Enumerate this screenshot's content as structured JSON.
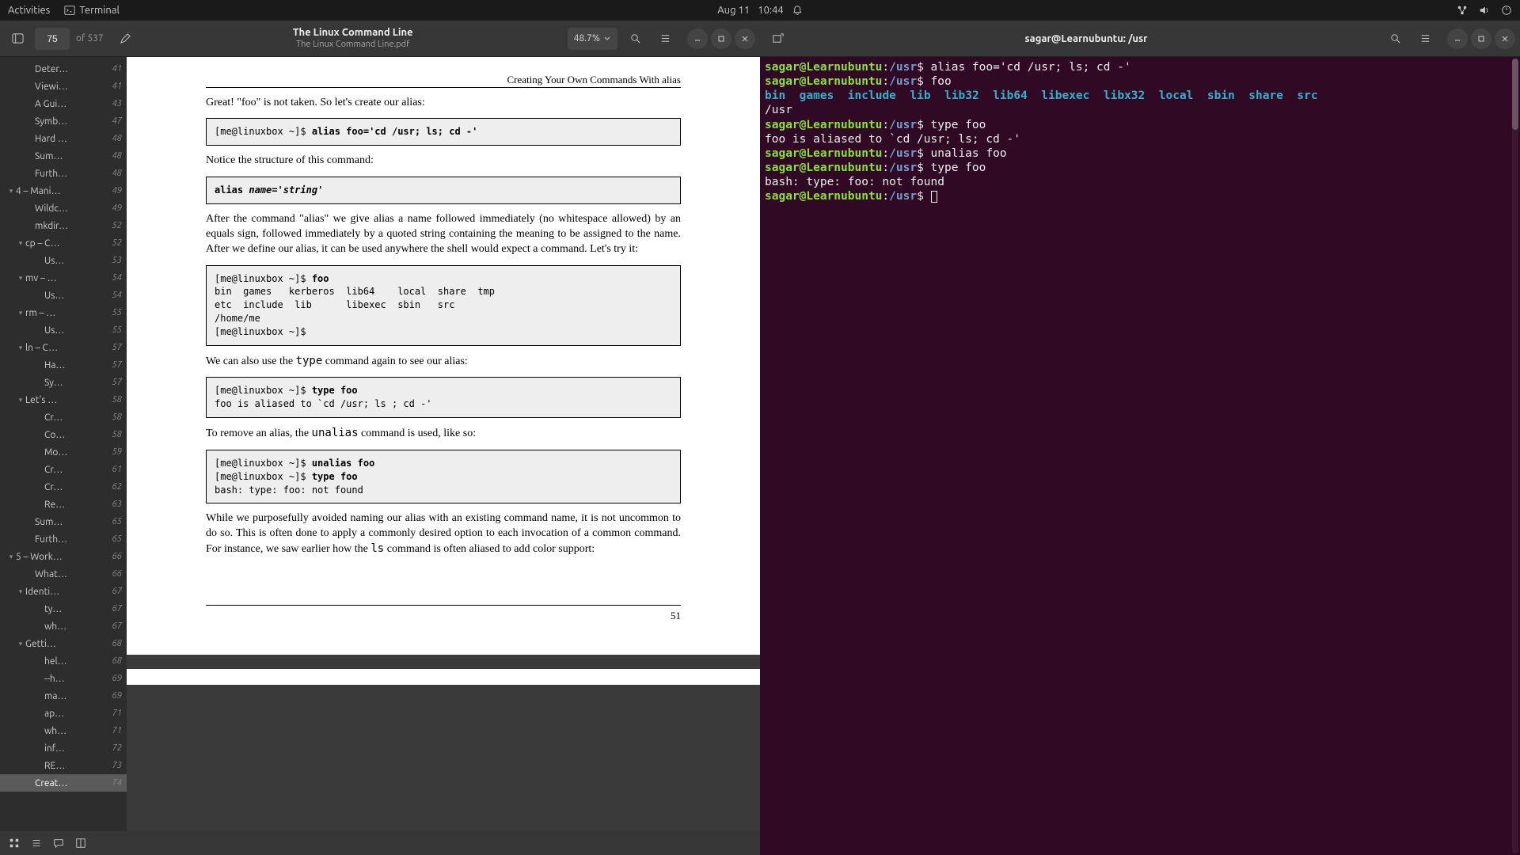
{
  "topbar": {
    "activities": "Activities",
    "app": "Terminal",
    "date": "Aug 11",
    "time": "10:44"
  },
  "pdf": {
    "title": "The Linux Command Line",
    "subtitle": "The Linux Command Line.pdf",
    "page_current": "75",
    "page_total": "of 537",
    "zoom": "48.7%",
    "outline": [
      {
        "indent": 2,
        "tri": "",
        "label": "Deter…",
        "pg": "41"
      },
      {
        "indent": 2,
        "tri": "",
        "label": "Viewi…",
        "pg": "41"
      },
      {
        "indent": 2,
        "tri": "",
        "label": "A Gui…",
        "pg": "43"
      },
      {
        "indent": 2,
        "tri": "",
        "label": "Symb…",
        "pg": "47"
      },
      {
        "indent": 2,
        "tri": "",
        "label": "Hard …",
        "pg": "48"
      },
      {
        "indent": 2,
        "tri": "",
        "label": "Sum…",
        "pg": "48"
      },
      {
        "indent": 2,
        "tri": "",
        "label": "Furth…",
        "pg": "48"
      },
      {
        "indent": 0,
        "tri": "▾",
        "label": "4 – Mani…",
        "pg": "49"
      },
      {
        "indent": 2,
        "tri": "",
        "label": "Wildc…",
        "pg": "49"
      },
      {
        "indent": 2,
        "tri": "",
        "label": "mkdir…",
        "pg": "52"
      },
      {
        "indent": 1,
        "tri": "▾",
        "label": "cp – C…",
        "pg": "52"
      },
      {
        "indent": 3,
        "tri": "",
        "label": "Us…",
        "pg": "53"
      },
      {
        "indent": 1,
        "tri": "▾",
        "label": "mv – …",
        "pg": "54"
      },
      {
        "indent": 3,
        "tri": "",
        "label": "Us…",
        "pg": "54"
      },
      {
        "indent": 1,
        "tri": "▾",
        "label": "rm – …",
        "pg": "55"
      },
      {
        "indent": 3,
        "tri": "",
        "label": "Us…",
        "pg": "55"
      },
      {
        "indent": 1,
        "tri": "▾",
        "label": "ln – C…",
        "pg": "57"
      },
      {
        "indent": 3,
        "tri": "",
        "label": "Ha…",
        "pg": "57"
      },
      {
        "indent": 3,
        "tri": "",
        "label": "Sy…",
        "pg": "57"
      },
      {
        "indent": 1,
        "tri": "▾",
        "label": "Let's …",
        "pg": "58"
      },
      {
        "indent": 3,
        "tri": "",
        "label": "Cr…",
        "pg": "58"
      },
      {
        "indent": 3,
        "tri": "",
        "label": "Co…",
        "pg": "58"
      },
      {
        "indent": 3,
        "tri": "",
        "label": "Mo…",
        "pg": "59"
      },
      {
        "indent": 3,
        "tri": "",
        "label": "Cr…",
        "pg": "61"
      },
      {
        "indent": 3,
        "tri": "",
        "label": "Cr…",
        "pg": "62"
      },
      {
        "indent": 3,
        "tri": "",
        "label": "Re…",
        "pg": "63"
      },
      {
        "indent": 2,
        "tri": "",
        "label": "Sum…",
        "pg": "65"
      },
      {
        "indent": 2,
        "tri": "",
        "label": "Furth…",
        "pg": "65"
      },
      {
        "indent": 0,
        "tri": "▾",
        "label": "5 – Work…",
        "pg": "66"
      },
      {
        "indent": 2,
        "tri": "",
        "label": "What…",
        "pg": "66"
      },
      {
        "indent": 1,
        "tri": "▾",
        "label": "Identi…",
        "pg": "67"
      },
      {
        "indent": 3,
        "tri": "",
        "label": "ty…",
        "pg": "67"
      },
      {
        "indent": 3,
        "tri": "",
        "label": "wh…",
        "pg": "67"
      },
      {
        "indent": 1,
        "tri": "▾",
        "label": "Getti…",
        "pg": "68"
      },
      {
        "indent": 3,
        "tri": "",
        "label": "hel…",
        "pg": "68"
      },
      {
        "indent": 3,
        "tri": "",
        "label": "--h…",
        "pg": "69"
      },
      {
        "indent": 3,
        "tri": "",
        "label": "ma…",
        "pg": "69"
      },
      {
        "indent": 3,
        "tri": "",
        "label": "ap…",
        "pg": "71"
      },
      {
        "indent": 3,
        "tri": "",
        "label": "wh…",
        "pg": "71"
      },
      {
        "indent": 3,
        "tri": "",
        "label": "inf…",
        "pg": "72"
      },
      {
        "indent": 3,
        "tri": "",
        "label": "RE…",
        "pg": "73"
      },
      {
        "indent": 2,
        "tri": "",
        "label": "Creat…",
        "pg": "74",
        "sel": true
      }
    ],
    "page": {
      "head": "Creating Your Own Commands With alias",
      "p1": "Great! \"foo\" is not taken. So let's create our alias:",
      "code1_a": "[me@linuxbox ~]$ ",
      "code1_b": "alias foo='cd /usr; ls; cd -'",
      "p2": "Notice the structure of this command:",
      "code2_a": "alias ",
      "code2_b": "name",
      "code2_c": "='",
      "code2_d": "string",
      "code2_e": "'",
      "p3": "After the command \"alias\" we give alias a name followed immediately (no whitespace allowed) by an equals sign, followed immediately by a quoted string containing the meaning to be assigned to the name. After we define our alias, it can be used anywhere the shell would expect a command. Let's try it:",
      "code3_a": "[me@linuxbox ~]$ ",
      "code3_b": "foo",
      "code3_c": "\nbin  games   kerberos  lib64    local  share  tmp\netc  include  lib      libexec  sbin   src\n/home/me\n[me@linuxbox ~]$",
      "p4_a": "We can also use the ",
      "p4_b": "type",
      "p4_c": " command again to see our alias:",
      "code4_a": "[me@linuxbox ~]$ ",
      "code4_b": "type foo",
      "code4_c": "\nfoo is aliased to `cd /usr; ls ; cd -'",
      "p5_a": "To remove an alias, the ",
      "p5_b": "unalias",
      "p5_c": " command is used, like so:",
      "code5_a": "[me@linuxbox ~]$ ",
      "code5_b": "unalias foo",
      "code5_c": "\n[me@linuxbox ~]$ ",
      "code5_d": "type foo",
      "code5_e": "\nbash: type: foo: not found",
      "p6_a": "While we purposefully avoided naming our alias with an existing command name, it is not uncommon to do so. This is often done to apply a commonly desired option to each invocation of a common command. For instance, we saw earlier how the ",
      "p6_b": "ls",
      "p6_c": " command is often aliased to add color support:",
      "pgno": "51"
    }
  },
  "term": {
    "title": "sagar@Learnubuntu: /usr",
    "user": "sagar@Learnubuntu",
    "path": "/usr",
    "lines": {
      "l1_cmd": "alias foo='cd /usr; ls; cd -'",
      "l2_cmd": "foo",
      "dirs": [
        "bin",
        "games",
        "include",
        "lib",
        "lib32",
        "lib64",
        "libexec",
        "libx32",
        "local",
        "sbin",
        "share",
        "src"
      ],
      "l3_out": "/usr",
      "l4_cmd": "type foo",
      "l4_out": "foo is aliased to `cd /usr; ls; cd -'",
      "l5_cmd": "unalias foo",
      "l6_cmd": "type foo",
      "l6_out": "bash: type: foo: not found"
    }
  }
}
